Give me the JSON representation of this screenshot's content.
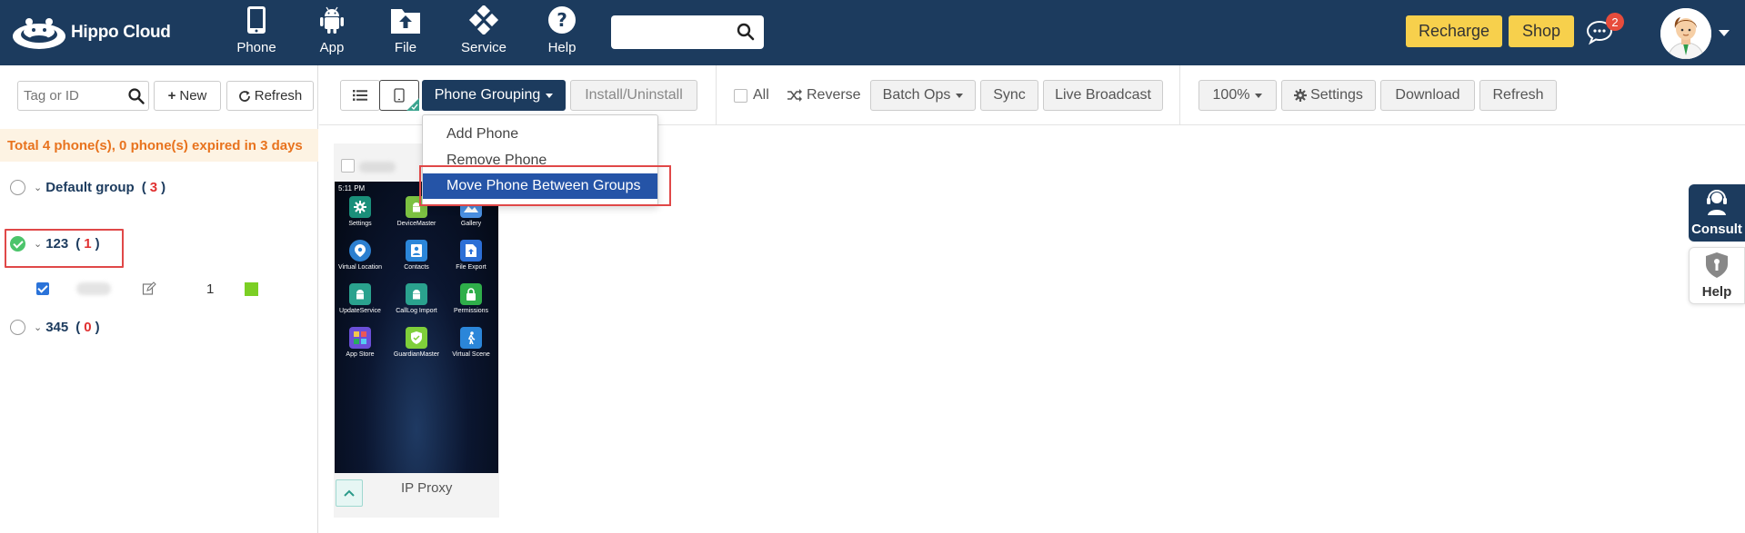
{
  "brand": {
    "name": "Hippo Cloud"
  },
  "nav": {
    "items": [
      {
        "label": "Phone",
        "icon": "phone-icon"
      },
      {
        "label": "App",
        "icon": "android-icon"
      },
      {
        "label": "File",
        "icon": "file-upload-icon"
      },
      {
        "label": "Service",
        "icon": "service-icon"
      },
      {
        "label": "Help",
        "icon": "help-icon"
      }
    ],
    "search": {
      "value": "",
      "placeholder": ""
    },
    "recharge_label": "Recharge",
    "shop_label": "Shop",
    "messages_badge": "2"
  },
  "sidebar": {
    "search": {
      "placeholder": "Tag or ID"
    },
    "new_label": "New",
    "refresh_label": "Refresh",
    "total_text": "Total 4 phone(s), 0 phone(s) expired in 3 days",
    "groups": [
      {
        "name": "Default group",
        "count": "3",
        "selected": false
      },
      {
        "name": "123",
        "count": "1",
        "selected": true
      },
      {
        "name": "345",
        "count": "0",
        "selected": false
      }
    ],
    "open_paren": "(",
    "close_paren": ")",
    "phone_rows": [
      {
        "number": "1",
        "status_color": "#7bcf24"
      }
    ]
  },
  "toolbar": {
    "phone_grouping_label": "Phone Grouping",
    "install_label": "Install/Uninstall",
    "all_label": "All",
    "reverse_label": "Reverse",
    "batch_ops_label": "Batch Ops",
    "sync_label": "Sync",
    "live_broadcast_label": "Live Broadcast",
    "zoom_label": "100%",
    "settings_label": "Settings",
    "download_label": "Download",
    "refresh_label": "Refresh"
  },
  "dropdown": {
    "items": [
      {
        "label": "Add Phone",
        "active": false
      },
      {
        "label": "Remove Phone",
        "active": false
      },
      {
        "label": "Move Phone Between Groups",
        "active": true
      }
    ]
  },
  "phone_card": {
    "status_time": "5:11 PM",
    "apps": [
      {
        "label": "Settings",
        "color": "#1a8f7a"
      },
      {
        "label": "DeviceMaster",
        "color": "#7cc142"
      },
      {
        "label": "Gallery",
        "color": "#4a8fe0"
      },
      {
        "label": "Virtual Location",
        "color": "#2b7fd0"
      },
      {
        "label": "Contacts",
        "color": "#2b86d9"
      },
      {
        "label": "File Export",
        "color": "#2c6fd6"
      },
      {
        "label": "UpdateService",
        "color": "#2aa28e"
      },
      {
        "label": "CallLog Import",
        "color": "#2aa28e"
      },
      {
        "label": "Permissions",
        "color": "#2fae4a"
      },
      {
        "label": "App Store",
        "color": "#6b4fd8"
      },
      {
        "label": "GuardianMaster",
        "color": "#7fcf3a"
      },
      {
        "label": "Virtual Scene",
        "color": "#2b86d9"
      }
    ],
    "ip_proxy_label": "IP Proxy"
  },
  "widgets": {
    "consult_label": "Consult",
    "help_label": "Help"
  },
  "colors": {
    "nav_bg": "#1c3b5e",
    "accent_yellow": "#f7d04c",
    "warning_orange": "#e8731e",
    "dropdown_active": "#2554a7",
    "highlight_red": "#e04848"
  }
}
